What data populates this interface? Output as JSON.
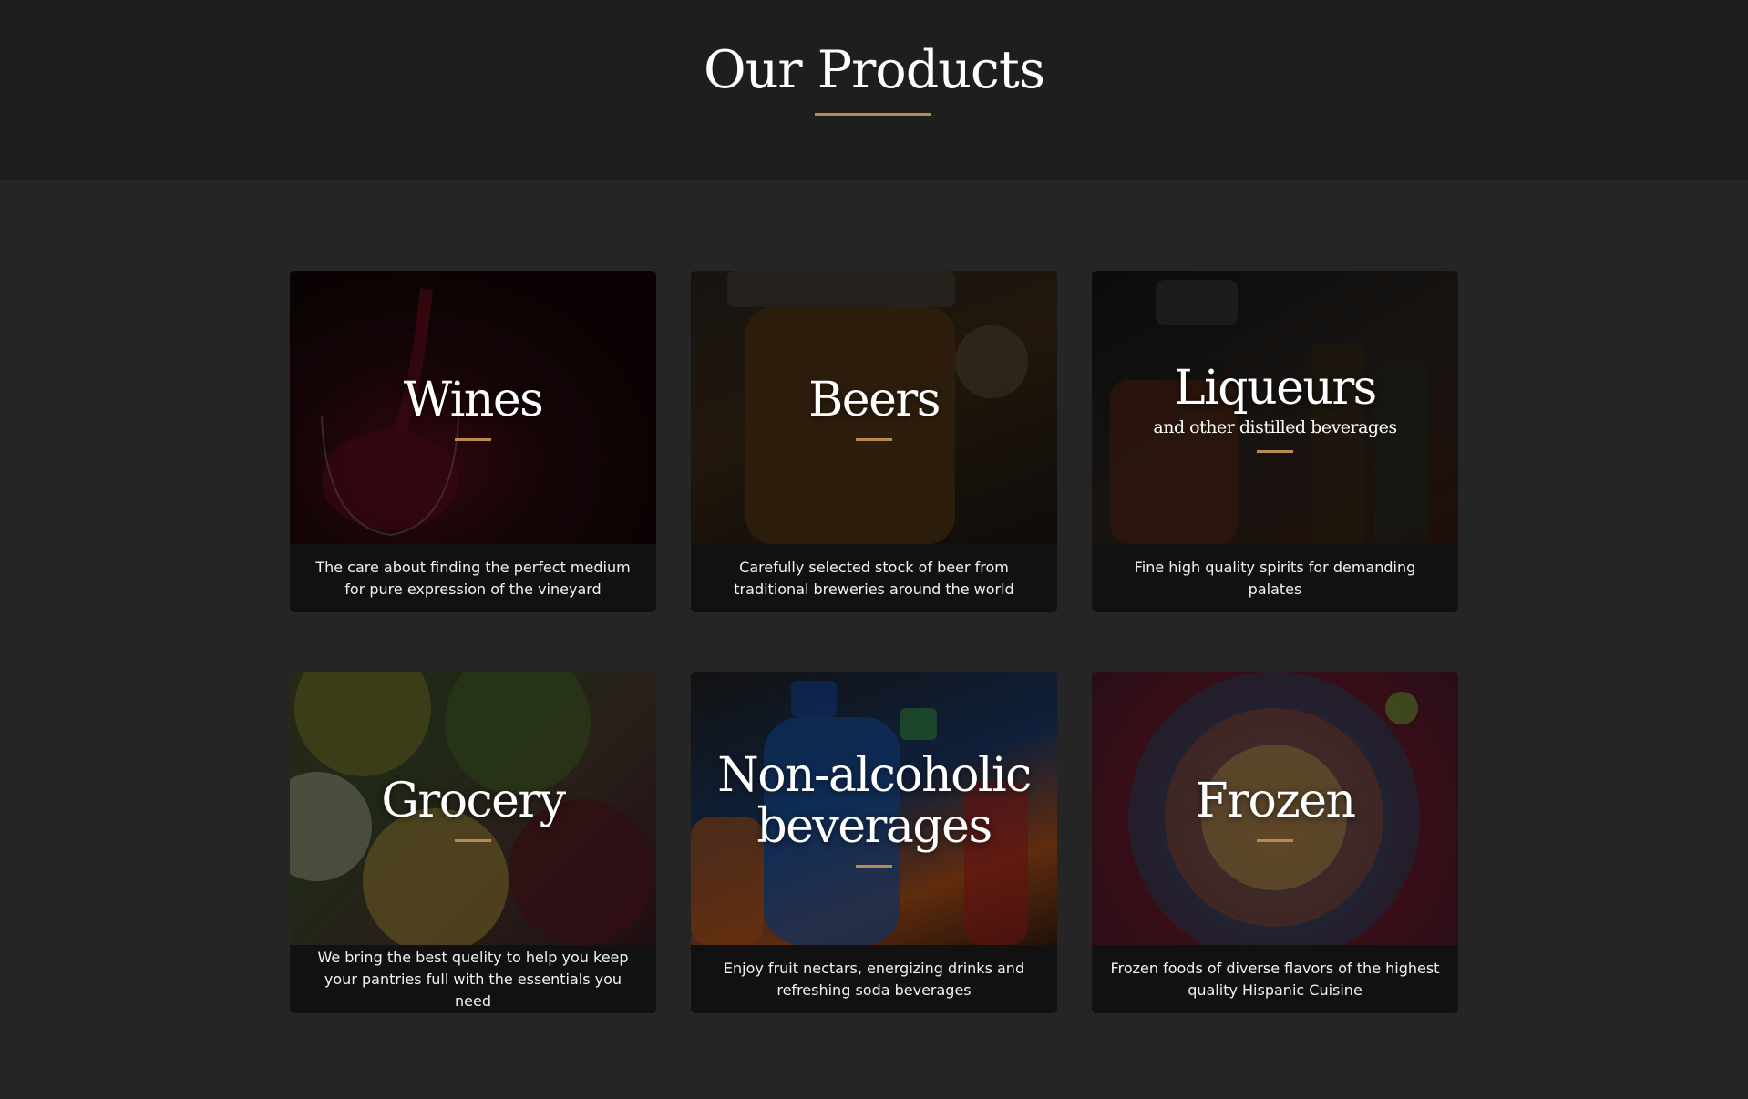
{
  "header": {
    "title": "Our Products"
  },
  "colors": {
    "accent": "#b98a4e",
    "background": "#252525",
    "header_background": "#1e1e1e",
    "card_body": "#111111"
  },
  "products": [
    {
      "title": "Wines",
      "subtitle": "",
      "description": "The care about finding the perfect medium for pure expression of the vineyard",
      "image": "wine-glass-photo"
    },
    {
      "title": "Beers",
      "subtitle": "",
      "description": "Carefully selected stock of beer from traditional breweries around the world",
      "image": "beer-bottle-photo"
    },
    {
      "title": "Liqueurs",
      "subtitle": "and other distilled beverages",
      "description": "Fine high quality spirits for demanding palates",
      "image": "liquor-bottles-photo"
    },
    {
      "title": "Grocery",
      "subtitle": "",
      "description": "We bring the best quelity to help you keep your pantries full with the essentials you need",
      "image": "canned-vegetables-photo"
    },
    {
      "title": "Non-alcoholic beverages",
      "subtitle": "",
      "description": "Enjoy fruit nectars, energizing drinks and refreshing soda beverages",
      "image": "soda-bottles-photo"
    },
    {
      "title": "Frozen",
      "subtitle": "",
      "description": "Frozen foods of diverse flavors of the highest quality Hispanic Cuisine",
      "image": "tamale-plate-photo"
    }
  ]
}
